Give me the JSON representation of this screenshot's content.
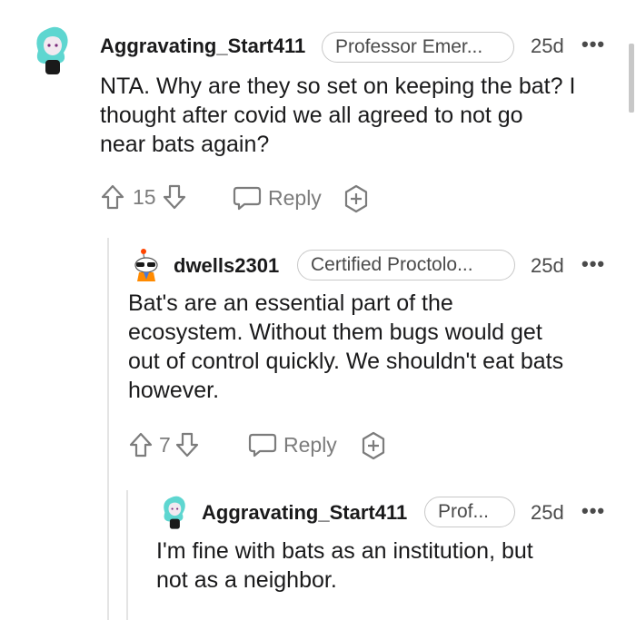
{
  "comments": [
    {
      "username": "Aggravating_Start411",
      "flair": "Professor Emer...",
      "age": "25d",
      "more": "•••",
      "body_lines": [
        "NTA. Why are they so set on keeping the bat? I",
        "thought after covid we all agreed to not go",
        "near bats again?"
      ],
      "score": "15",
      "reply_label": "Reply"
    },
    {
      "username": "dwells2301",
      "flair": "Certified Proctolo...",
      "age": "25d",
      "more": "•••",
      "body_lines": [
        "Bat's are an essential part of the",
        "ecosystem. Without them bugs would get",
        "out of control quickly. We shouldn't eat bats",
        "however."
      ],
      "score": "7",
      "reply_label": "Reply"
    },
    {
      "username": "Aggravating_Start411",
      "flair": "Prof...",
      "age": "25d",
      "more": "•••",
      "body_lines": [
        "I'm fine with bats as an institution, but",
        "not as a neighbor."
      ]
    }
  ],
  "icons": {
    "upvote": "upvote-icon",
    "downvote": "downvote-icon",
    "reply": "speech-bubble-icon",
    "award": "award-plus-icon",
    "more": "more-options-icon"
  },
  "colors": {
    "text": "#1a1a1b",
    "meta": "#4a4a4a",
    "action": "#7c7c7c",
    "thread_line": "#e4e4e4"
  }
}
